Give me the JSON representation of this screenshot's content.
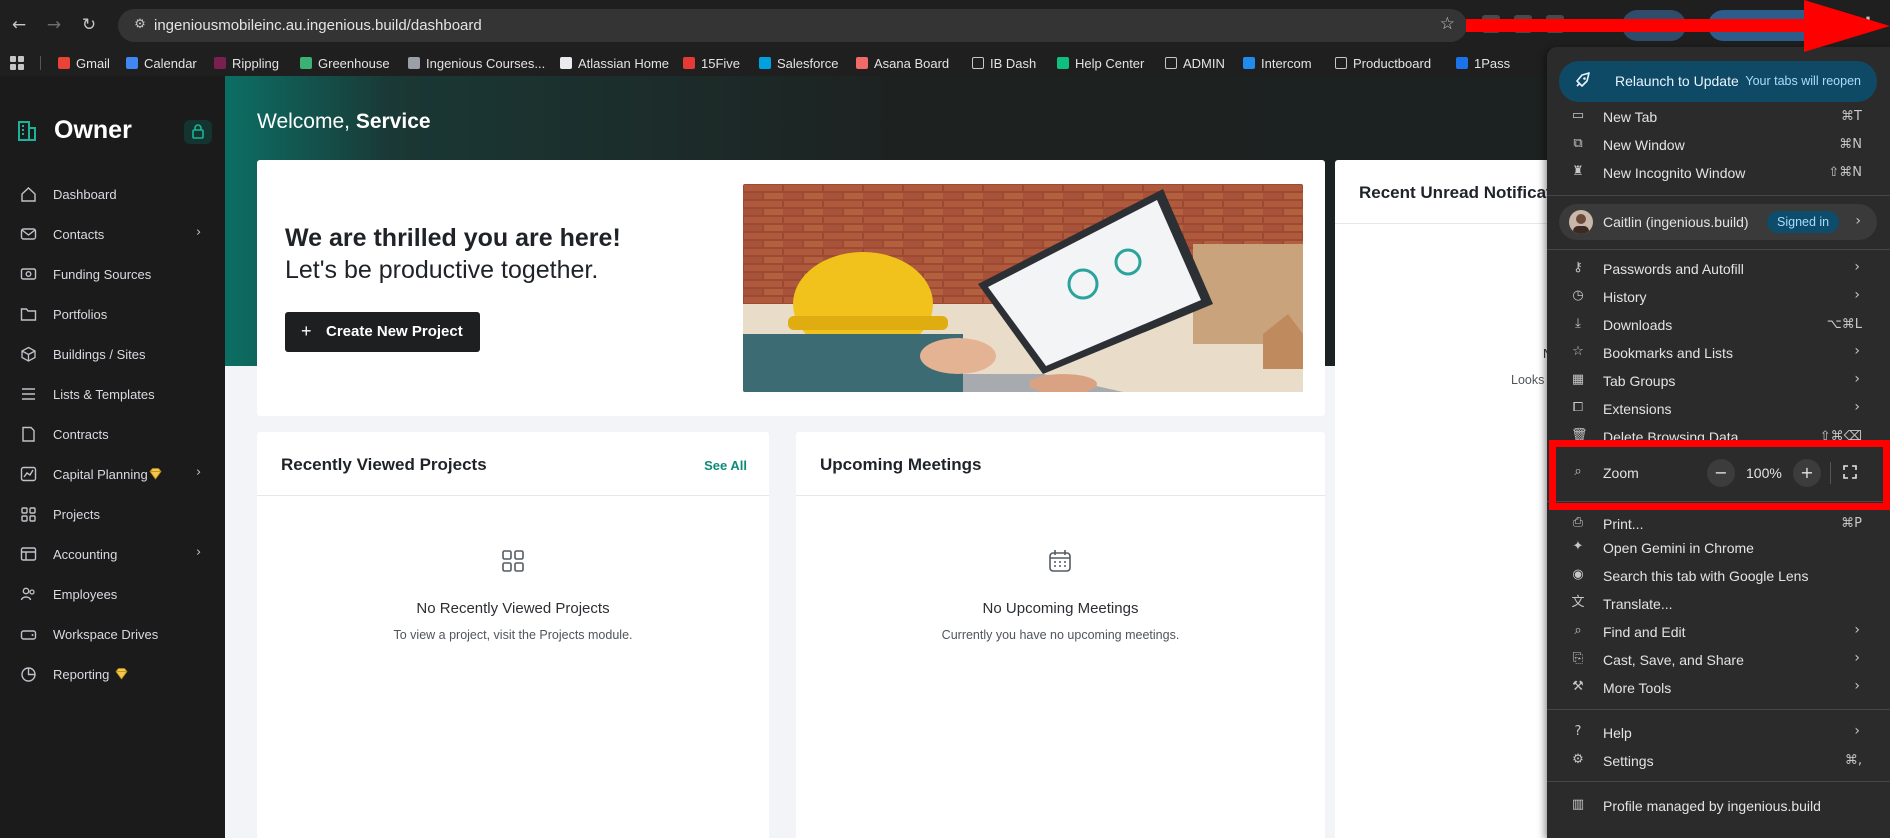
{
  "browser": {
    "url": "ingeniousmobileinc.au.ingenious.build/dashboard",
    "bookmarks": [
      {
        "label": "Gmail",
        "color": "#ea4335"
      },
      {
        "label": "Calendar",
        "color": "#4285f4"
      },
      {
        "label": "Rippling",
        "color": "#7a2050"
      },
      {
        "label": "Greenhouse",
        "color": "#3bb273"
      },
      {
        "label": "Ingenious Courses...",
        "color": "#9aa0a6"
      },
      {
        "label": "Atlassian Home",
        "color": "#e8eaed"
      },
      {
        "label": "15Five",
        "color": "#e53935"
      },
      {
        "label": "Salesforce",
        "color": "#00a1e0"
      },
      {
        "label": "Asana Board",
        "color": "#f06a6a"
      },
      {
        "label": "IB Dash",
        "color": "folder"
      },
      {
        "label": "Help Center",
        "color": "#0fbf7f"
      },
      {
        "label": "ADMIN",
        "color": "folder"
      },
      {
        "label": "Intercom",
        "color": "#1f8ded"
      },
      {
        "label": "Productboard",
        "color": "folder"
      },
      {
        "label": "1Pass",
        "color": "#1a73e8"
      }
    ]
  },
  "app": {
    "brand": "Owner",
    "accent": "#0f8a78",
    "nav": [
      {
        "label": "Dashboard",
        "icon": "home-icon",
        "chevron": false,
        "premium": false
      },
      {
        "label": "Contacts",
        "icon": "mail-icon",
        "chevron": true,
        "premium": false
      },
      {
        "label": "Funding Sources",
        "icon": "cash-icon",
        "chevron": false,
        "premium": false
      },
      {
        "label": "Portfolios",
        "icon": "folder-icon",
        "chevron": false,
        "premium": false
      },
      {
        "label": "Buildings / Sites",
        "icon": "cube-icon",
        "chevron": false,
        "premium": false
      },
      {
        "label": "Lists & Templates",
        "icon": "list-icon",
        "chevron": false,
        "premium": false
      },
      {
        "label": "Contracts",
        "icon": "document-icon",
        "chevron": false,
        "premium": false
      },
      {
        "label": "Capital Planning",
        "icon": "chart-icon",
        "chevron": true,
        "premium": true
      },
      {
        "label": "Projects",
        "icon": "grid-icon",
        "chevron": false,
        "premium": false
      },
      {
        "label": "Accounting",
        "icon": "ledger-icon",
        "chevron": true,
        "premium": false
      },
      {
        "label": "Employees",
        "icon": "people-icon",
        "chevron": false,
        "premium": false
      },
      {
        "label": "Workspace Drives",
        "icon": "drive-icon",
        "chevron": false,
        "premium": false
      },
      {
        "label": "Reporting",
        "icon": "pie-icon",
        "chevron": false,
        "premium": true
      }
    ]
  },
  "dashboard": {
    "welcome_prefix": "Welcome,",
    "welcome_name": "Service",
    "hero_title": "We are thrilled you are here!",
    "hero_subtitle": "Let's be productive together.",
    "create_button": "Create New Project",
    "recent": {
      "title": "Recently Viewed Projects",
      "see_all": "See All",
      "empty_title": "No Recently Viewed Projects",
      "empty_sub": "To view a project, visit the Projects module."
    },
    "meetings": {
      "title": "Upcoming Meetings",
      "empty_title": "No Upcoming Meetings",
      "empty_sub": "Currently you have no upcoming meetings."
    },
    "notifications": {
      "title": "Recent Unread Notificati",
      "partial_line_1": "N",
      "partial_line_2": "Looks"
    }
  },
  "menu": {
    "relaunch_label": "Relaunch to Update",
    "relaunch_note": "Your tabs will reopen",
    "new_tab": {
      "label": "New Tab",
      "shortcut": "⌘T"
    },
    "new_window": {
      "label": "New Window",
      "shortcut": "⌘N"
    },
    "new_incognito": {
      "label": "New Incognito Window",
      "shortcut": "⇧⌘N"
    },
    "profile_name": "Caitlin (ingenious.build)",
    "profile_status": "Signed in",
    "passwords": "Passwords and Autofill",
    "history": "History",
    "downloads": {
      "label": "Downloads",
      "shortcut": "⌥⌘L"
    },
    "bookmarks_lists": "Bookmarks and Lists",
    "tab_groups": "Tab Groups",
    "extensions": "Extensions",
    "delete_browsing": {
      "label": "Delete Browsing Data...",
      "shortcut": "⇧⌘⌫"
    },
    "zoom": {
      "label": "Zoom",
      "value": "100%",
      "minus": "−",
      "plus": "+"
    },
    "print": {
      "label": "Print...",
      "shortcut": "⌘P"
    },
    "gemini": "Open Gemini in Chrome",
    "lens": "Search this tab with Google Lens",
    "translate": "Translate...",
    "find_edit": "Find and Edit",
    "cast_save": "Cast, Save, and Share",
    "more_tools": "More Tools",
    "help": "Help",
    "settings": {
      "label": "Settings",
      "shortcut": "⌘,"
    },
    "managed": "Profile managed by ingenious.build"
  },
  "annotations": {
    "highlight_color": "#ff0000"
  }
}
